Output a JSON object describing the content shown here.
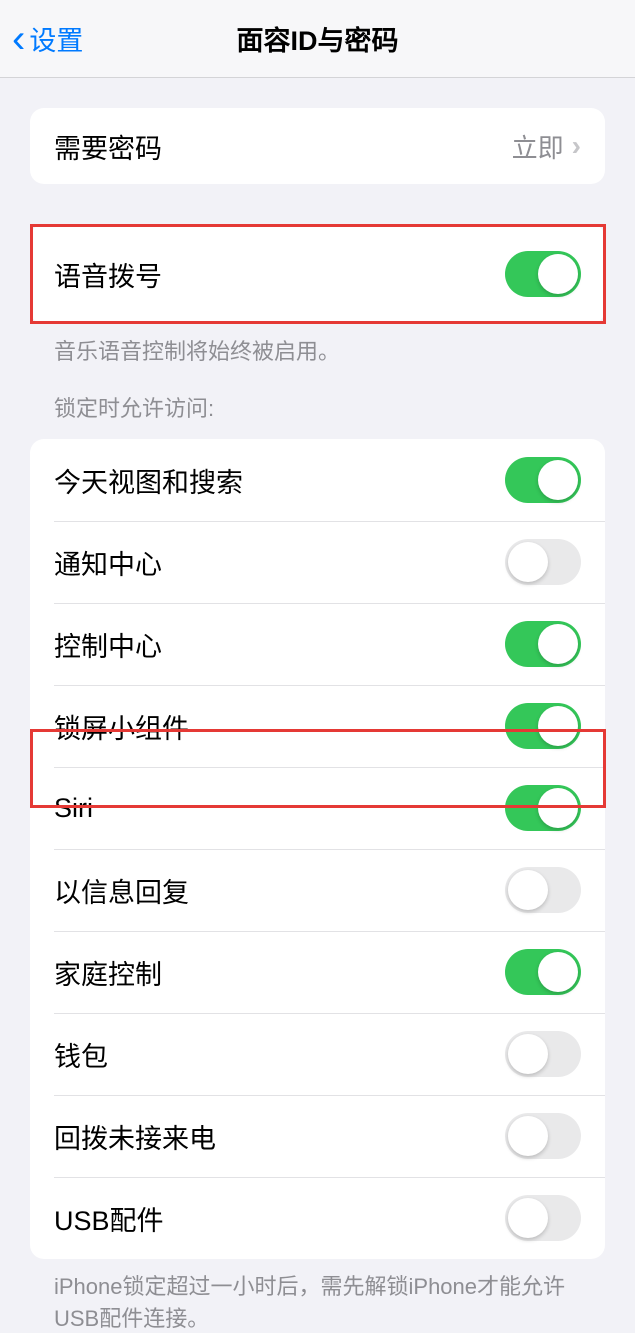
{
  "nav": {
    "back_label": "设置",
    "title": "面容ID与密码"
  },
  "passcode": {
    "label": "需要密码",
    "value": "立即"
  },
  "voice_dial": {
    "label": "语音拨号",
    "footer": "音乐语音控制将始终被启用。"
  },
  "lock_access": {
    "header": "锁定时允许访问:",
    "items": [
      {
        "label": "今天视图和搜索",
        "on": true
      },
      {
        "label": "通知中心",
        "on": false
      },
      {
        "label": "控制中心",
        "on": true
      },
      {
        "label": "锁屏小组件",
        "on": true
      },
      {
        "label": "Siri",
        "on": true
      },
      {
        "label": "以信息回复",
        "on": false
      },
      {
        "label": "家庭控制",
        "on": true
      },
      {
        "label": "钱包",
        "on": false
      },
      {
        "label": "回拨未接来电",
        "on": false
      },
      {
        "label": "USB配件",
        "on": false
      }
    ],
    "footer": "iPhone锁定超过一小时后，需先解锁iPhone才能允许USB配件连接。"
  }
}
